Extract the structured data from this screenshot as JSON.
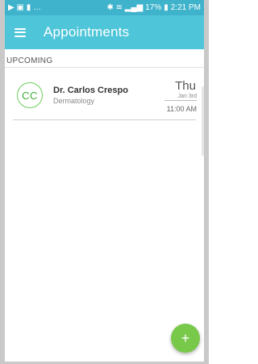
{
  "status_bar": {
    "left_glyphs": "▶ ▣ ▮ …",
    "right_glyphs": "✱ ≋ ▂▄▆",
    "battery": "17%",
    "time": "2:21 PM"
  },
  "app_bar": {
    "title": "Appointments",
    "menu_icon": "hamburger-menu-icon",
    "color": "#4ec5d9"
  },
  "upcoming": {
    "section_label": "UPCOMING",
    "appointments": [
      {
        "initials": "CC",
        "doctor": "Dr. Carlos Crespo",
        "specialty": "Dermatology",
        "day": "Thu",
        "date": "Jan 3rd",
        "time": "11:00 AM"
      }
    ]
  },
  "fab": {
    "label": "+",
    "icon": "plus-icon",
    "color": "#78c84a"
  }
}
